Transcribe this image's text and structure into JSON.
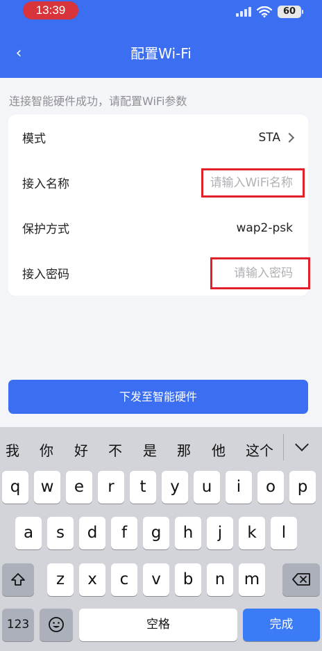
{
  "status_bar": {
    "time": "13:39",
    "battery": "60"
  },
  "nav": {
    "back": "‹",
    "title": "配置Wi-Fi"
  },
  "hint": "连接智能硬件成功，请配置WiFi参数",
  "form": {
    "mode": {
      "label": "模式",
      "value": "STA"
    },
    "ssid": {
      "label": "接入名称",
      "placeholder": "请输入WiFi名称",
      "value": ""
    },
    "security": {
      "label": "保护方式",
      "value": "wap2-psk"
    },
    "password": {
      "label": "接入密码",
      "placeholder": "请输入密码",
      "value": ""
    }
  },
  "submit_label": "下发至智能硬件",
  "keyboard": {
    "candidates": [
      "我",
      "你",
      "好",
      "不",
      "是",
      "那",
      "他",
      "这个"
    ],
    "row1": [
      "q",
      "w",
      "e",
      "r",
      "t",
      "y",
      "u",
      "i",
      "o",
      "p"
    ],
    "row2": [
      "a",
      "s",
      "d",
      "f",
      "g",
      "h",
      "j",
      "k",
      "l"
    ],
    "row3": [
      "z",
      "x",
      "c",
      "v",
      "b",
      "n",
      "m"
    ],
    "numbers_label": "123",
    "space_label": "空格",
    "done_label": "完成"
  },
  "colors": {
    "primary": "#3b6ef0",
    "annotation": "#e2202a"
  }
}
